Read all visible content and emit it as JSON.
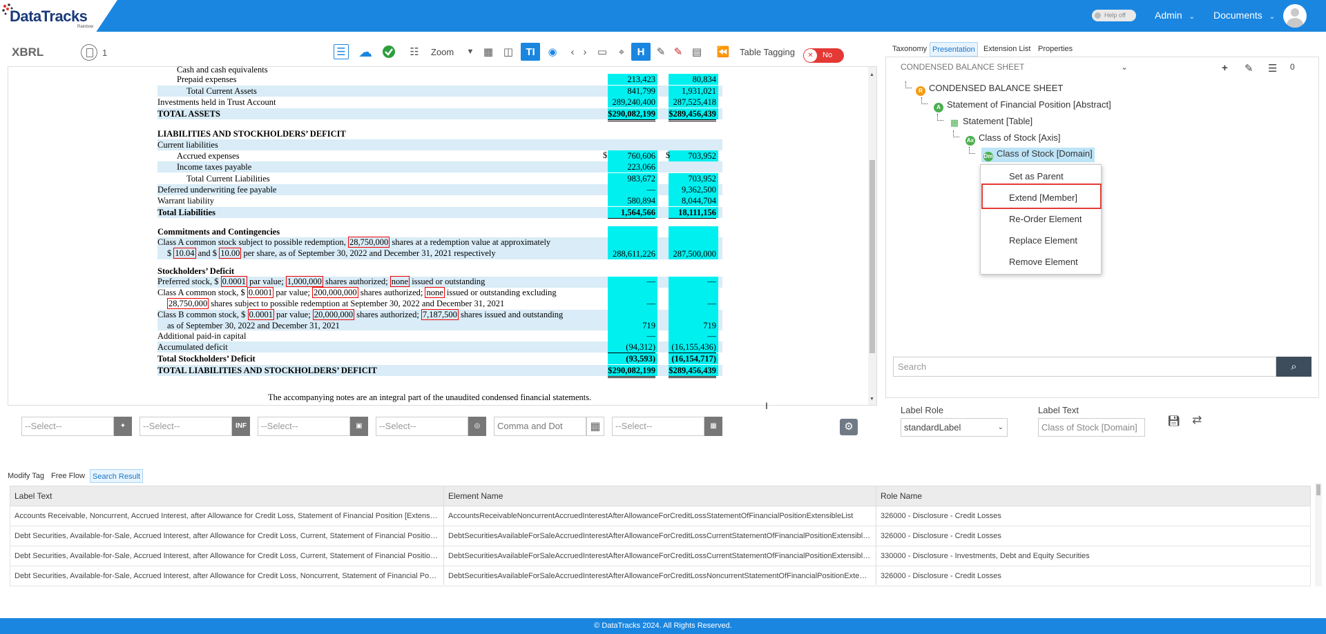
{
  "header": {
    "logo": "DataTracks",
    "logo_sub": "Rainbow",
    "help": "Help off",
    "admin": "Admin",
    "documents": "Documents"
  },
  "toolbar": {
    "title": "XBRL",
    "page": "1",
    "zoom": "Zoom",
    "table_tagging": "Table Tagging",
    "table_tagging_state": "No"
  },
  "statement": {
    "rows": [
      {
        "label": "Cash and cash equivalents",
        "indent": 2,
        "v1": "",
        "v2": "",
        "hl": false
      },
      {
        "label": "Prepaid expenses",
        "indent": 2,
        "v1": "213,423",
        "v2": "80,834",
        "hl": false
      },
      {
        "label": "Total Current Assets",
        "indent": 3,
        "v1": "841,799",
        "v2": "1,931,021",
        "hl": true
      },
      {
        "label": "Investments held in Trust Account",
        "indent": 0,
        "v1": "289,240,400",
        "v2": "287,525,418",
        "hl": false
      },
      {
        "label": "TOTAL ASSETS",
        "indent": 0,
        "v1": "$290,082,199",
        "v2": "$289,456,439",
        "hl": true,
        "bold": true
      },
      {
        "label": "LIABILITIES AND STOCKHOLDERS’ DEFICIT",
        "indent": 0,
        "v1": "",
        "v2": "",
        "hl": false,
        "bold": true
      },
      {
        "label": "Current liabilities",
        "indent": 0,
        "v1": "",
        "v2": "",
        "hl": true
      },
      {
        "label": "Accrued expenses",
        "indent": 2,
        "v1": "760,606",
        "v2": "703,952",
        "hl": false
      },
      {
        "label": "Income taxes payable",
        "indent": 2,
        "v1": "223,066",
        "v2": "",
        "hl": true
      },
      {
        "label": "Total Current Liabilities",
        "indent": 3,
        "v1": "983,672",
        "v2": "703,952",
        "hl": false
      },
      {
        "label": "Deferred underwriting fee payable",
        "indent": 0,
        "v1": "—",
        "v2": "9,362,500",
        "hl": true
      },
      {
        "label": "Warrant liability",
        "indent": 0,
        "v1": "580,894",
        "v2": "8,044,704",
        "hl": false
      },
      {
        "label": "Total Liabilities",
        "indent": 0,
        "v1": "1,564,566",
        "v2": "18,111,156",
        "hl": true,
        "bold": true
      },
      {
        "label": "Commitments and Contingencies",
        "indent": 0,
        "v1": "",
        "v2": "",
        "hl": false,
        "bold": true
      },
      {
        "label": "Stockholders’ Deficit",
        "indent": 0,
        "v1": "",
        "v2": "",
        "hl": false,
        "bold": true
      },
      {
        "label": "Additional paid-in capital",
        "indent": 0,
        "v1": "—",
        "v2": "—",
        "hl": false
      },
      {
        "label": "Accumulated deficit",
        "indent": 0,
        "v1": "(94,312)",
        "v2": "(16,155,436)",
        "hl": true
      },
      {
        "label": "Total Stockholders’ Deficit",
        "indent": 0,
        "v1": "(93,593)",
        "v2": "(16,154,717)",
        "hl": false,
        "bold": true
      },
      {
        "label": "TOTAL LIABILITIES AND STOCKHOLDERS’ DEFICIT",
        "indent": 0,
        "v1": "$290,082,199",
        "v2": "$289,456,439",
        "hl": true,
        "bold": true
      }
    ],
    "classA_redeem": {
      "t1": "Class A common stock subject to possible redemption,",
      "n1": "28,750,000",
      "t2": "shares at a redemption value at approximately",
      "t3": "$",
      "n2": "10.04",
      "t4": "and $",
      "n3": "10.00",
      "t5": "per share, as of September 30, 2022 and December 31, 2021 respectively",
      "v1": "288,611,226",
      "v2": "287,500,000"
    },
    "preferred": {
      "t1": "Preferred stock, $",
      "n1": "0.0001",
      "t2": "par value;",
      "n2": "1,000,000",
      "t3": "shares authorized;",
      "n3": "none",
      "t4": "issued or outstanding",
      "v1": "—",
      "v2": "—"
    },
    "classA": {
      "t1": "Class A common stock, $",
      "n1": "0.0001",
      "t2": "par value;",
      "n2": "200,000,000",
      "t3": "shares authorized;",
      "n3": "none",
      "t4": "issued or outstanding excluding",
      "n4": "28,750,000",
      "t5": "shares subject to possible redemption at September 30, 2022 and December 31, 2021",
      "v1": "—",
      "v2": "—"
    },
    "classB": {
      "t1": "Class B common stock, $",
      "n1": "0.0001",
      "t2": "par value;",
      "n2": "20,000,000",
      "t3": "shares authorized;",
      "n3": "7,187,500",
      "t4": "shares issued and outstanding",
      "t5": "as of September 30, 2022 and December 31, 2021",
      "v1": "719",
      "v2": "719"
    },
    "dollar": "$",
    "footer_note": "The accompanying notes are an integral part of the unaudited condensed financial statements."
  },
  "selectbar": {
    "s1": "--Select--",
    "s2": "--Select--",
    "s2_btn": "INF",
    "s3": "--Select--",
    "s4": "--Select--",
    "s5": "Comma and Dot",
    "s6": "--Select--"
  },
  "right_panel": {
    "tabs": [
      "Taxonomy",
      "Presentation",
      "Extension List",
      "Properties"
    ],
    "active_tab": "Presentation",
    "dropdown": "CONDENSED BALANCE SHEET",
    "count": "0",
    "tree": [
      {
        "label": "CONDENSED BALANCE SHEET",
        "icon": "R",
        "color": "#f39c12"
      },
      {
        "label": "Statement of Financial Position [Abstract]",
        "icon": "A",
        "color": "#4caf50"
      },
      {
        "label": "Statement [Table]",
        "icon": "",
        "color": "#4caf50"
      },
      {
        "label": "Class of Stock [Axis]",
        "icon": "Ax",
        "color": "#4caf50"
      },
      {
        "label": "Class of Stock [Domain]",
        "icon": "Dm",
        "color": "#4caf50"
      }
    ],
    "context_menu": [
      "Set as Parent",
      "Extend [Member]",
      "Re-Order Element",
      "Replace Element",
      "Remove Element"
    ],
    "search_placeholder": "Search",
    "label_role_title": "Label Role",
    "label_role_value": "standardLabel",
    "label_text_title": "Label Text",
    "label_text_value": "Class of Stock [Domain]"
  },
  "bottom": {
    "tabs": [
      "Modify Tag",
      "Free Flow",
      "Search Result"
    ],
    "active_tab": "Search Result",
    "columns": [
      "Label Text",
      "Element Name",
      "Role Name"
    ],
    "rows": [
      [
        "Accounts Receivable, Noncurrent, Accrued Interest, after Allowance for Credit Loss, Statement of Financial Position [Extensible Enumeration]",
        "AccountsReceivableNoncurrentAccruedInterestAfterAllowanceForCreditLossStatementOfFinancialPositionExtensibleList",
        "326000 - Disclosure - Credit Losses"
      ],
      [
        "Debt Securities, Available-for-Sale, Accrued Interest, after Allowance for Credit Loss, Current, Statement of Financial Position [Extensible Enumeration]",
        "DebtSecuritiesAvailableForSaleAccruedInterestAfterAllowanceForCreditLossCurrentStatementOfFinancialPositionExtensibleList",
        "326000 - Disclosure - Credit Losses"
      ],
      [
        "Debt Securities, Available-for-Sale, Accrued Interest, after Allowance for Credit Loss, Current, Statement of Financial Position [Extensible Enumeration]",
        "DebtSecuritiesAvailableForSaleAccruedInterestAfterAllowanceForCreditLossCurrentStatementOfFinancialPositionExtensibleList",
        "330000 - Disclosure - Investments, Debt and Equity Securities"
      ],
      [
        "Debt Securities, Available-for-Sale, Accrued Interest, after Allowance for Credit Loss, Noncurrent, Statement of Financial Position [Extensible Enumeration]",
        "DebtSecuritiesAvailableForSaleAccruedInterestAfterAllowanceForCreditLossNoncurrentStatementOfFinancialPositionExtensibleList",
        "326000 - Disclosure - Credit Losses"
      ]
    ]
  },
  "footer": "© DataTracks 2024. All Rights Reserved.",
  "colors": {
    "brand": "#1a86e0",
    "tag_cyan": "#00f0f0",
    "highlight": "#e53935"
  }
}
